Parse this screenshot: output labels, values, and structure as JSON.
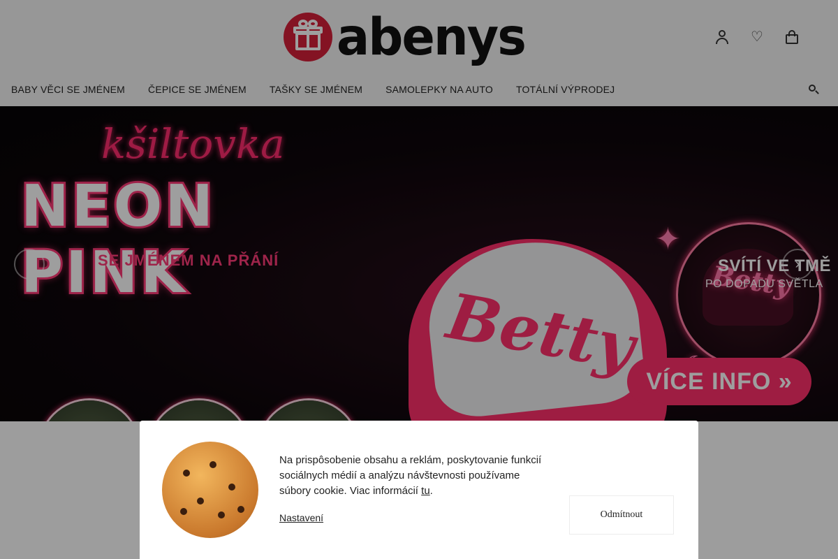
{
  "header": {
    "logo_text": "abenys",
    "icons": [
      "user-icon",
      "heart-icon",
      "cart-icon"
    ]
  },
  "nav": {
    "items": [
      "BABY VĚCI SE JMÉNEM",
      "ČEPICE SE JMÉNEM",
      "TAŠKY SE JMÉNEM",
      "SAMOLEPKY NA AUTO",
      "TOTÁLNÍ VÝPRODEJ"
    ],
    "search_icon": "search-icon"
  },
  "banner": {
    "script_title": "kšiltovka",
    "main_title": "NEON PINK",
    "subtitle": "SE JMÉNEM NA PŘÁNÍ",
    "cap_name": "Betty",
    "glow_title": "SVÍTÍ VE TMĚ",
    "glow_sub": "PO DOPADU SVĚTLA",
    "cta": "VÍCE INFO »",
    "prev_arrow": "‹",
    "next_arrow": "›",
    "accent_color": "#ff2f6b"
  },
  "cookie": {
    "text_before": "Na prispôsobenie obsahu a reklám, poskytovanie funkcií sociálnych médií a analýzu návštevnosti používame súbory cookie. Viac informácií ",
    "link": "tu",
    "text_after": ".",
    "settings": "Nastavení",
    "decline": "Odmítnout"
  }
}
